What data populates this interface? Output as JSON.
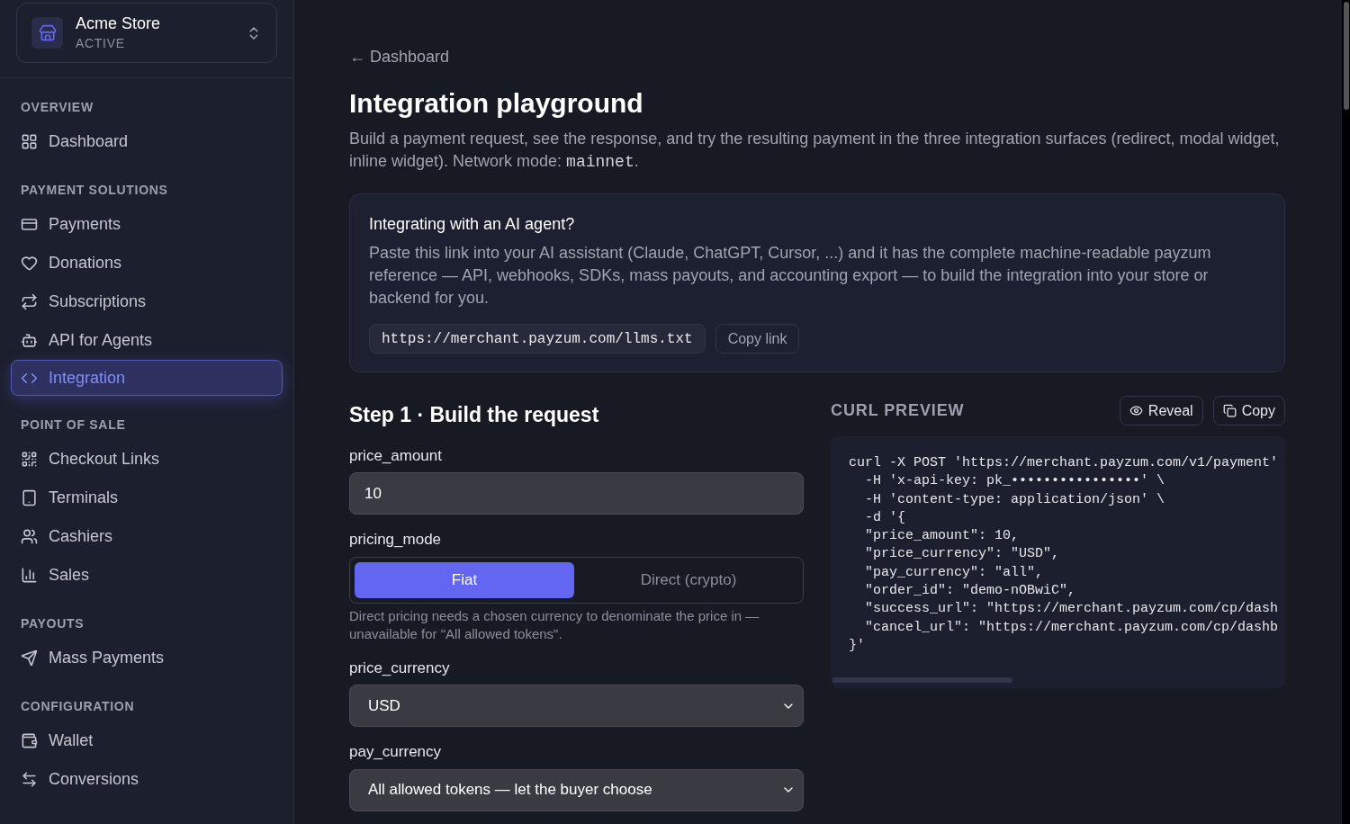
{
  "store": {
    "name": "Acme Store",
    "status": "ACTIVE"
  },
  "sidebar": {
    "groups": [
      {
        "label": "OVERVIEW",
        "items": [
          {
            "label": "Dashboard",
            "selected": false
          }
        ]
      },
      {
        "label": "PAYMENT SOLUTIONS",
        "items": [
          {
            "label": "Payments",
            "selected": false
          },
          {
            "label": "Donations",
            "selected": false
          },
          {
            "label": "Subscriptions",
            "selected": false
          },
          {
            "label": "API for Agents",
            "selected": false
          },
          {
            "label": "Integration",
            "selected": true
          }
        ]
      },
      {
        "label": "POINT OF SALE",
        "items": [
          {
            "label": "Checkout Links",
            "selected": false
          },
          {
            "label": "Terminals",
            "selected": false
          },
          {
            "label": "Cashiers",
            "selected": false
          },
          {
            "label": "Sales",
            "selected": false
          }
        ]
      },
      {
        "label": "PAYOUTS",
        "items": [
          {
            "label": "Mass Payments",
            "selected": false
          }
        ]
      },
      {
        "label": "CONFIGURATION",
        "items": [
          {
            "label": "Wallet",
            "selected": false
          },
          {
            "label": "Conversions",
            "selected": false
          }
        ]
      }
    ]
  },
  "back_link": "← Dashboard",
  "title": "Integration playground",
  "description": "Build a payment request, see the response, and try the resulting payment in the three integration surfaces (redirect, modal widget, inline widget). Network mode: ",
  "network_mode": "mainnet",
  "description_end": ".",
  "agent_card": {
    "title": "Integrating with an AI agent?",
    "text": "Paste this link into your AI assistant (Claude, ChatGPT, Cursor, ...) and it has the complete machine-readable payzum reference — API, webhooks, SDKs, mass payouts, and accounting export — to build the integration into your store or backend for you.",
    "url": "https://merchant.payzum.com/llms.txt",
    "copy_button": "Copy link"
  },
  "step": {
    "title": "Step 1 · Build the request",
    "fields": [
      {
        "kind": "input",
        "label": "price_amount",
        "value": "10"
      },
      {
        "kind": "segmented",
        "label": "pricing_mode",
        "options": [
          {
            "label": "Fiat",
            "selected": true
          },
          {
            "label": "Direct (crypto)",
            "selected": false
          }
        ],
        "hint": "Direct pricing needs a chosen currency to denominate the price in — unavailable for \"All allowed tokens\"."
      },
      {
        "kind": "select",
        "label": "price_currency",
        "value": "USD"
      },
      {
        "kind": "select",
        "label": "pay_currency",
        "value": "All allowed tokens — let the buyer choose"
      }
    ]
  },
  "curl_preview": {
    "title": "CURL PREVIEW",
    "buttons": [
      "Reveal",
      "Copy"
    ],
    "lines": [
      "curl -X POST 'https://merchant.payzum.com/v1/payment'",
      "  -H 'x-api-key: pk_••••••••••••••••' \\",
      "  -H 'content-type: application/json' \\",
      "  -d '{",
      "  \"price_amount\": 10,",
      "  \"price_currency\": \"USD\",",
      "  \"pay_currency\": \"all\",",
      "  \"order_id\": \"demo-nOBwiC\",",
      "  \"success_url\": \"https://merchant.payzum.com/cp/dash",
      "  \"cancel_url\": \"https://merchant.payzum.com/cp/dashb",
      "}'"
    ]
  }
}
